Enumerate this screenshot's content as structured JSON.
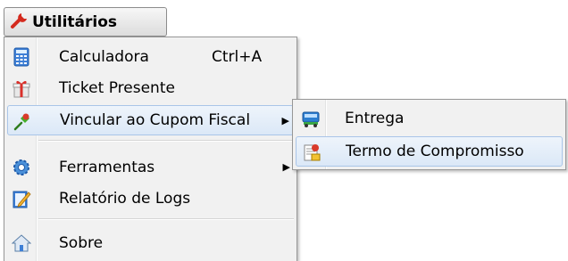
{
  "menubar": {
    "title": "Utilitários",
    "icon": "wrench-icon"
  },
  "menu": {
    "items": [
      {
        "label": "Calculadora",
        "shortcut": "Ctrl+A",
        "icon": "calculator-icon"
      },
      {
        "label": "Ticket Presente",
        "icon": "gift-icon"
      },
      {
        "label": "Vincular ao Cupom Fiscal",
        "icon": "pin-icon",
        "highlighted": true,
        "has_submenu": true
      },
      {
        "label": "Ferramentas",
        "icon": "gear-icon",
        "has_submenu": true
      },
      {
        "label": "Relatório de Logs",
        "icon": "edit-report-icon"
      },
      {
        "label": "Sobre",
        "icon": "home-icon"
      }
    ]
  },
  "submenu": {
    "items": [
      {
        "label": "Entrega",
        "icon": "delivery-truck-icon"
      },
      {
        "label": "Termo de Compromisso",
        "icon": "document-icon",
        "highlighted": true
      }
    ]
  },
  "colors": {
    "highlight_bg": "#dbe8f7",
    "highlight_border": "#a9c5e8",
    "menu_bg": "#f1f1f1"
  }
}
